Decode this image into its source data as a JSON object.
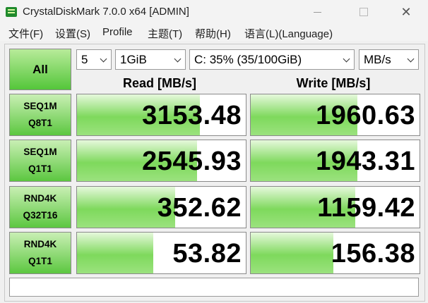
{
  "window": {
    "title": "CrystalDiskMark 7.0.0 x64 [ADMIN]",
    "minimize_glyph": "",
    "close_glyph": "✕"
  },
  "menu": {
    "items": [
      "文件(F)",
      "设置(S)",
      "Profile",
      "主题(T)",
      "帮助(H)",
      "语言(L)(Language)"
    ]
  },
  "controls": {
    "all_label": "All",
    "count": "5",
    "size": "1GiB",
    "drive": "C: 35% (35/100GiB)",
    "unit": "MB/s"
  },
  "headers": {
    "read": "Read [MB/s]",
    "write": "Write [MB/s]"
  },
  "rows": [
    {
      "line1": "SEQ1M",
      "line2": "Q8T1",
      "read": "3153.48",
      "write": "1960.63",
      "read_fill": 0.73,
      "write_fill": 0.63
    },
    {
      "line1": "SEQ1M",
      "line2": "Q1T1",
      "read": "2545.93",
      "write": "1943.31",
      "read_fill": 0.71,
      "write_fill": 0.63
    },
    {
      "line1": "RND4K",
      "line2": "Q32T16",
      "read": "352.62",
      "write": "1159.42",
      "read_fill": 0.58,
      "write_fill": 0.62
    },
    {
      "line1": "RND4K",
      "line2": "Q1T1",
      "read": "53.82",
      "write": "156.38",
      "read_fill": 0.45,
      "write_fill": 0.49
    }
  ],
  "comment": ""
}
